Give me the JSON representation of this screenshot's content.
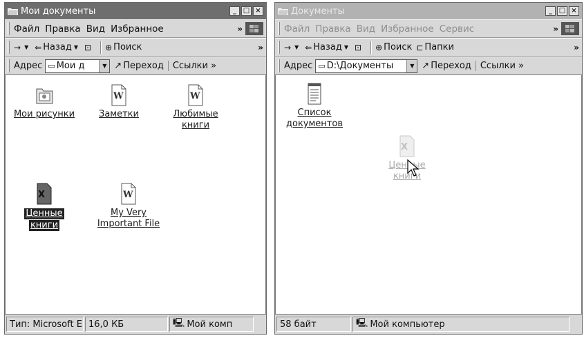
{
  "left": {
    "title": "Мои документы",
    "menu": [
      "Файл",
      "Правка",
      "Вид",
      "Избранное"
    ],
    "toolbar": {
      "back": "Назад",
      "search": "Поиск"
    },
    "address": {
      "label": "Адрес",
      "value": "Мои д",
      "go": "Переход",
      "links": "Ссылки"
    },
    "items": [
      {
        "label": "Мои рисунки",
        "icon": "folder-pictures-icon"
      },
      {
        "label": "Заметки",
        "icon": "word-document-icon"
      },
      {
        "label": "Любимые",
        "label2": "книги",
        "icon": "word-document-icon"
      },
      {
        "label": "Ценные",
        "label2": "книги",
        "icon": "excel-document-icon",
        "selected": true
      },
      {
        "label": "My Very",
        "label2": "Important File",
        "icon": "word-document-icon"
      }
    ],
    "status": {
      "type": "Тип: Microsoft E",
      "size": "16,0 КБ",
      "computer": "Мой комп"
    }
  },
  "right": {
    "title": "Документы",
    "menu": [
      "Файл",
      "Правка",
      "Вид",
      "Избранное",
      "Сервис"
    ],
    "toolbar": {
      "back": "Назад",
      "search": "Поиск",
      "folders": "Папки"
    },
    "address": {
      "label": "Адрес",
      "value": "D:\\Документы",
      "go": "Переход",
      "links": "Ссылки"
    },
    "items": [
      {
        "label": "Список",
        "label2": "документов",
        "icon": "text-document-icon"
      },
      {
        "label": "Ценные",
        "label2": "книги",
        "icon": "excel-document-icon",
        "dragging": true
      }
    ],
    "status": {
      "size": "58 байт",
      "computer": "Мой компьютер"
    }
  }
}
